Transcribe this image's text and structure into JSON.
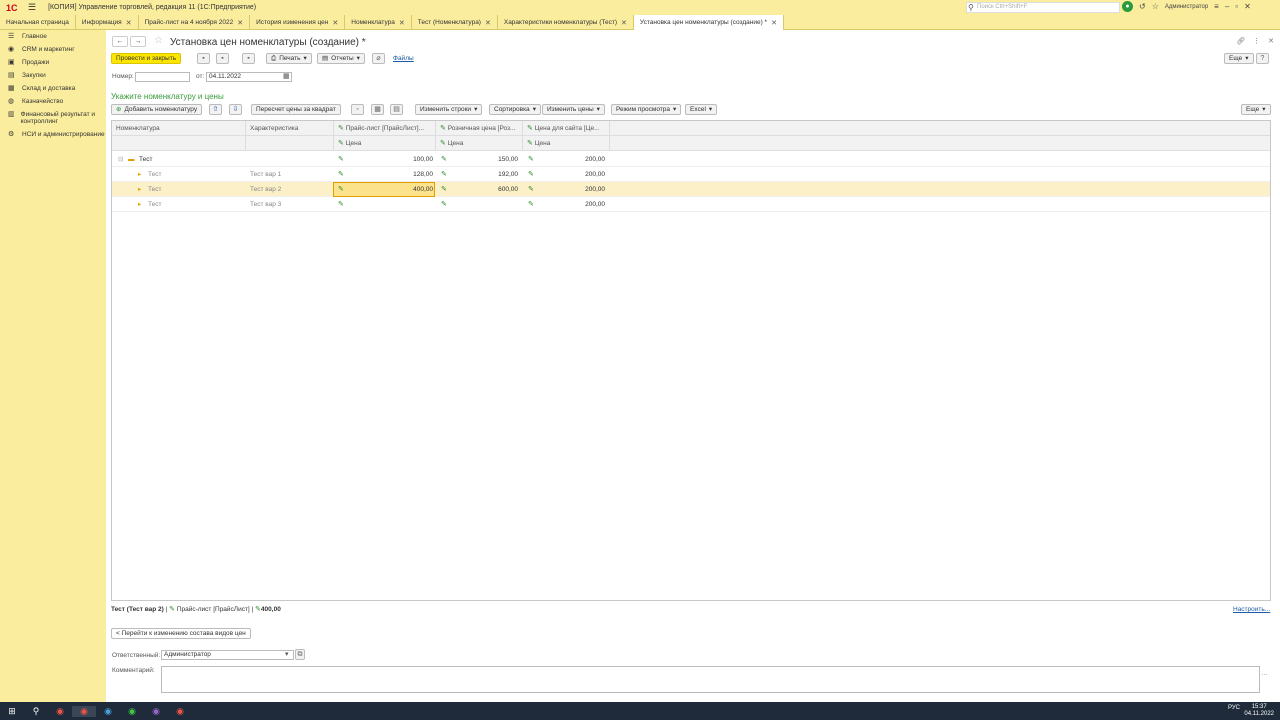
{
  "titlebar": {
    "logo": "1С",
    "app_title": "[КОПИЯ] Управление торговлей, редакция 11 (1С:Предприятие)",
    "search_placeholder": "Поиск Ctrl+Shift+F",
    "user": "Администратор"
  },
  "tabs": [
    {
      "label": "Начальная страница",
      "closable": false
    },
    {
      "label": "Информация",
      "closable": true
    },
    {
      "label": "Прайс-лист на 4 ноября 2022",
      "closable": true
    },
    {
      "label": "История изменения цен",
      "closable": true
    },
    {
      "label": "Номенклатура",
      "closable": true
    },
    {
      "label": "Тест (Номенклатура)",
      "closable": true
    },
    {
      "label": "Характеристики номенклатуры (Тест)",
      "closable": true
    },
    {
      "label": "Установка цен номенклатуры (создание) *",
      "closable": true
    }
  ],
  "sidebar": [
    "Главное",
    "CRM и маркетинг",
    "Продажи",
    "Закупки",
    "Склад и доставка",
    "Казначейство",
    "Финансовый результат и контроллинг",
    "НСИ и администрирование"
  ],
  "page": {
    "title": "Установка цен номенклатуры (создание) *"
  },
  "toolbar": {
    "post_close": "Провести и закрыть",
    "print": "Печать",
    "reports": "Отчеты",
    "files": "Файлы",
    "more": "Еще",
    "help": "?"
  },
  "form": {
    "number_label": "Номер:",
    "number_value": "",
    "date_label": "от:",
    "date_value": "04.11.2022"
  },
  "section_title": "Укажите номенклатуру и цены",
  "table_toolbar": {
    "add": "Добавить номенклатуру",
    "recalc": "Пересчет цены за квадрат",
    "change_rows": "Изменить строки",
    "sort": "Сортировка",
    "change_prices": "Изменить цены",
    "view_mode": "Режим просмотра",
    "excel": "Excel",
    "more": "Еще"
  },
  "columns": {
    "nomenclature": "Номенклатура",
    "characteristic": "Характеристика",
    "price_list": "Прайс-лист [ПрайсЛист]...",
    "retail": "Розничная цена [Роз...",
    "site": "Цена для сайта [Це...",
    "price_sub": "Цена"
  },
  "rows": [
    {
      "name": "Тест",
      "char": "",
      "p1": "100,00",
      "p2": "150,00",
      "p3": "200,00"
    },
    {
      "name": "Тест",
      "char": "Тест вар 1",
      "p1": "128,00",
      "p2": "192,00",
      "p3": "200,00"
    },
    {
      "name": "Тест",
      "char": "Тест вар 2",
      "p1": "400,00",
      "p2": "600,00",
      "p3": "200,00"
    },
    {
      "name": "Тест",
      "char": "Тест вар 3",
      "p1": "",
      "p2": "",
      "p3": "200,00"
    }
  ],
  "status": {
    "item": "Тест (Тест вар 2)",
    "price_type": "Прайс-лист [ПрайсЛист]",
    "value": "400,00",
    "settings": "Настроить..."
  },
  "bottom": {
    "goto_btn": "< Перейти к изменению состава видов цен",
    "responsible_label": "Ответственный:",
    "responsible_value": "Администратор",
    "comment_label": "Комментарий:",
    "comment_value": ""
  },
  "taskbar": {
    "lang": "РУС",
    "time": "15:37",
    "date": "04.11.2022"
  }
}
